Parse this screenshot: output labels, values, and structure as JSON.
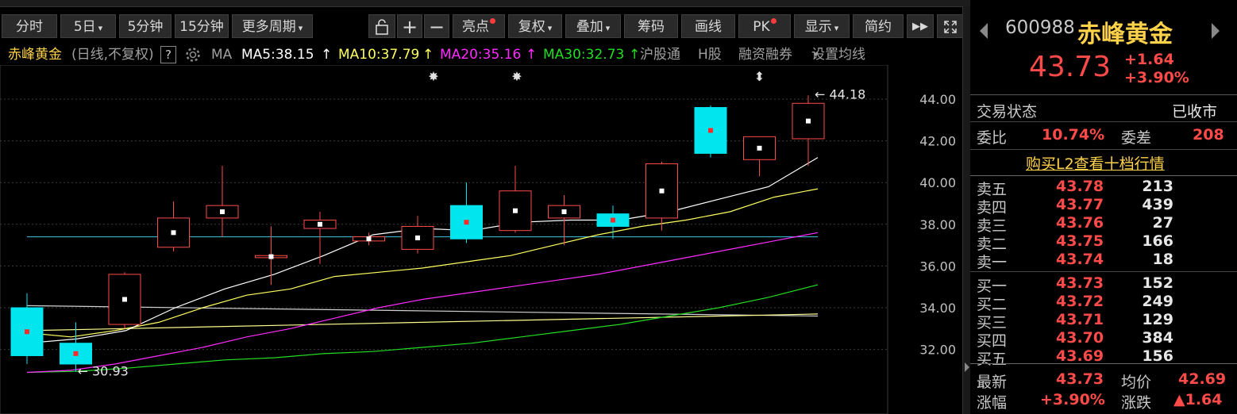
{
  "toolbar": {
    "buttons": [
      {
        "label": "分时",
        "caret": false,
        "dot": false
      },
      {
        "label": "5日",
        "caret": true,
        "dot": false
      },
      {
        "label": "5分钟",
        "caret": false,
        "dot": false
      },
      {
        "label": "15分钟",
        "caret": false,
        "dot": false
      },
      {
        "label": "更多周期",
        "caret": true,
        "dot": false
      },
      {
        "label": "",
        "icon": "lock-icon"
      },
      {
        "label": "",
        "icon": "plus-icon"
      },
      {
        "label": "",
        "icon": "minus-icon"
      },
      {
        "label": "亮点",
        "caret": false,
        "dot": true
      },
      {
        "label": "复权",
        "caret": true,
        "dot": false
      },
      {
        "label": "叠加",
        "caret": true,
        "dot": false
      },
      {
        "label": "筹码",
        "caret": false,
        "dot": false
      },
      {
        "label": "画线",
        "caret": false,
        "dot": false
      },
      {
        "label": "PK",
        "caret": false,
        "dot": true
      },
      {
        "label": "显示",
        "caret": true,
        "dot": false
      },
      {
        "label": "简约",
        "caret": false,
        "dot": false
      },
      {
        "label": "",
        "icon": "double-chevron-right-icon"
      },
      {
        "label": "",
        "icon": "expand-icon"
      }
    ]
  },
  "info": {
    "stock_name": "赤峰黄金",
    "mode": "(日线,不复权)",
    "help": "?",
    "ma_label": "MA",
    "ma5": "MA5:38.15",
    "ma10": "MA10:37.79",
    "ma20": "MA20:35.16",
    "ma30": "MA30:32.73",
    "arrow": "↑",
    "hgt": "沪股通",
    "hshare": "H股",
    "margin": "融资融券",
    "settings": "设置均线"
  },
  "colors": {
    "up": "#ff4a4a",
    "down": "#00e5ee",
    "ma5": "#ffffff",
    "ma10": "#ffff60",
    "ma20": "#ff2aff",
    "ma30": "#22dd22",
    "accent": "#ffd24a"
  },
  "chart_data": {
    "type": "candlestick",
    "ylim": [
      31,
      45
    ],
    "yticks": [
      "44.00",
      "42.00",
      "40.00",
      "38.00",
      "36.00",
      "34.00",
      "32.00"
    ],
    "ytick_values": [
      44,
      42,
      40,
      38,
      36,
      34,
      32
    ],
    "candles": [
      {
        "o": 34.0,
        "c": 31.7,
        "h": 34.7,
        "l": 31.3
      },
      {
        "o": 32.3,
        "c": 31.3,
        "h": 33.3,
        "l": 30.93
      },
      {
        "o": 33.2,
        "c": 35.6,
        "h": 35.7,
        "l": 33.0
      },
      {
        "o": 36.9,
        "c": 38.3,
        "h": 39.1,
        "l": 36.7
      },
      {
        "o": 38.3,
        "c": 38.9,
        "h": 40.8,
        "l": 37.4
      },
      {
        "o": 36.4,
        "c": 36.5,
        "h": 37.9,
        "l": 35.1
      },
      {
        "o": 37.8,
        "c": 38.2,
        "h": 38.6,
        "l": 36.1
      },
      {
        "o": 37.2,
        "c": 37.4,
        "h": 37.6,
        "l": 37.0
      },
      {
        "o": 36.8,
        "c": 37.9,
        "h": 38.4,
        "l": 36.6
      },
      {
        "o": 38.9,
        "c": 37.3,
        "h": 40.0,
        "l": 37.1
      },
      {
        "o": 37.7,
        "c": 39.6,
        "h": 40.8,
        "l": 37.6
      },
      {
        "o": 38.3,
        "c": 38.9,
        "h": 39.4,
        "l": 37.0
      },
      {
        "o": 38.5,
        "c": 37.9,
        "h": 38.9,
        "l": 37.3
      },
      {
        "o": 38.3,
        "c": 40.9,
        "h": 41.0,
        "l": 37.7
      },
      {
        "o": 43.6,
        "c": 41.4,
        "h": 43.7,
        "l": 41.2
      },
      {
        "o": 41.1,
        "c": 42.2,
        "h": 42.2,
        "l": 40.3
      },
      {
        "o": 42.1,
        "c": 43.8,
        "h": 44.18,
        "l": 40.8
      }
    ],
    "ma5": [
      32.3,
      32.5,
      32.9,
      34.0,
      34.9,
      35.6,
      36.5,
      37.5,
      37.8,
      37.7,
      38.1,
      38.2,
      38.2,
      38.6,
      39.2,
      39.8,
      41.2
    ],
    "ma10": [
      32.8,
      32.6,
      32.9,
      33.3,
      34.0,
      34.6,
      34.9,
      35.5,
      35.7,
      35.9,
      36.2,
      36.5,
      37.0,
      37.5,
      37.9,
      38.2,
      38.6,
      39.3,
      39.7
    ],
    "ma20": [
      30.9,
      31.0,
      31.3,
      31.7,
      32.1,
      32.6,
      33.0,
      33.5,
      34.0,
      34.4,
      34.7,
      35.0,
      35.3,
      35.6,
      36.0,
      36.4,
      36.8,
      37.2,
      37.6
    ],
    "ma30": [
      30.9,
      30.95,
      31.1,
      31.3,
      31.5,
      31.6,
      31.8,
      31.9,
      32.1,
      32.3,
      32.6,
      32.9,
      33.2,
      33.6,
      34.0,
      34.5,
      35.1
    ],
    "hline_cyan": 37.4,
    "long_ma_white": [
      34.1,
      33.6
    ],
    "long_ma_yellow": [
      32.9,
      33.7
    ],
    "annotations": {
      "high_label": "44.18",
      "low_label": "30.93",
      "high_arrow": "←",
      "low_arrow": "←"
    },
    "markers": [
      {
        "index": 8,
        "glyph": "✸"
      },
      {
        "index": 10,
        "glyph": "✸"
      },
      {
        "index": 15,
        "glyph": "⬍"
      }
    ]
  },
  "panel": {
    "code": "600988",
    "name": "赤峰黄金",
    "price": "43.73",
    "change": "+1.64",
    "change_pct": "+3.90%",
    "status_label": "交易状态",
    "status_value": "已收市",
    "wb_label": "委比",
    "wb_value": "10.74%",
    "wc_label": "委差",
    "wc_value": "208",
    "l2_link": "购买L2查看十档行情",
    "asks": [
      {
        "label": "卖五",
        "price": "43.78",
        "vol": "213"
      },
      {
        "label": "卖四",
        "price": "43.77",
        "vol": "439"
      },
      {
        "label": "卖三",
        "price": "43.76",
        "vol": "27"
      },
      {
        "label": "卖二",
        "price": "43.75",
        "vol": "166"
      },
      {
        "label": "卖一",
        "price": "43.74",
        "vol": "18"
      }
    ],
    "bids": [
      {
        "label": "买一",
        "price": "43.73",
        "vol": "152"
      },
      {
        "label": "买二",
        "price": "43.72",
        "vol": "249"
      },
      {
        "label": "买三",
        "price": "43.71",
        "vol": "129"
      },
      {
        "label": "买四",
        "price": "43.70",
        "vol": "384"
      },
      {
        "label": "买五",
        "price": "43.69",
        "vol": "156"
      }
    ],
    "latest_label": "最新",
    "latest_value": "43.73",
    "avg_label": "均价",
    "avg_value": "42.69",
    "pct_label": "涨幅",
    "pct_value": "+3.90%",
    "chg_label": "涨跌",
    "chg_value": "▲1.64"
  }
}
